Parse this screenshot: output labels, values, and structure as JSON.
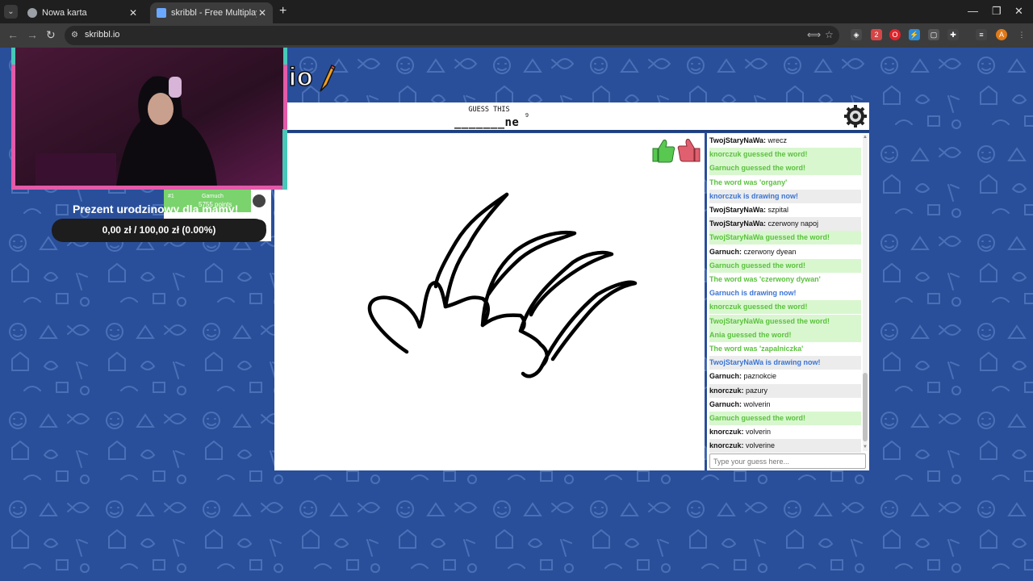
{
  "browser": {
    "tabs": [
      {
        "title": "Nowa karta",
        "active": false
      },
      {
        "title": "skribbl - Free Multiplayer Drawi",
        "active": true
      }
    ],
    "url": "skribbl.io"
  },
  "game": {
    "logo_suffix": "io",
    "header_label": "GUESS THIS",
    "hint": "_______ne",
    "hint_count": "9",
    "chat": [
      {
        "name": "TwojStaryNaWa:",
        "text": " wrecz",
        "kind": "plain",
        "alt": false
      },
      {
        "text": "knorczuk guessed the word!",
        "kind": "green",
        "bg": true
      },
      {
        "text": "Garnuch guessed the word!",
        "kind": "green",
        "bg": true
      },
      {
        "text": "The word was 'organy'",
        "kind": "green",
        "bg": false
      },
      {
        "text": "knorczuk is drawing now!",
        "kind": "blue",
        "alt": true
      },
      {
        "name": "TwojStaryNaWa:",
        "text": " szpital",
        "kind": "plain",
        "alt": false
      },
      {
        "name": "TwojStaryNaWa:",
        "text": " czerwony napoj",
        "kind": "plain",
        "alt": true
      },
      {
        "text": "TwojStaryNaWa guessed the word!",
        "kind": "green",
        "bg": true
      },
      {
        "name": "Garnuch:",
        "text": " czerwony dyean",
        "kind": "plain",
        "alt": false
      },
      {
        "text": "Garnuch guessed the word!",
        "kind": "green",
        "bg": true
      },
      {
        "text": "The word was 'czerwony dywan'",
        "kind": "green",
        "bg": false
      },
      {
        "text": "Garnuch is drawing now!",
        "kind": "blue",
        "alt": false
      },
      {
        "text": "knorczuk guessed the word!",
        "kind": "green",
        "bg": true
      },
      {
        "text": "TwojStaryNaWa guessed the word!",
        "kind": "green",
        "bg": true
      },
      {
        "text": "Ania guessed the word!",
        "kind": "green",
        "bg": true
      },
      {
        "text": "The word was 'zapalniczka'",
        "kind": "green",
        "bg": false
      },
      {
        "text": "TwojStaryNaWa is drawing now!",
        "kind": "blue",
        "alt": true
      },
      {
        "name": "Garnuch:",
        "text": " paznokcie",
        "kind": "plain",
        "alt": false
      },
      {
        "name": "knorczuk:",
        "text": " pazury",
        "kind": "plain",
        "alt": true
      },
      {
        "name": "Garnuch:",
        "text": " wolverin",
        "kind": "plain",
        "alt": false
      },
      {
        "text": "Garnuch guessed the word!",
        "kind": "green",
        "bg": true
      },
      {
        "name": "knorczuk:",
        "text": " volverin",
        "kind": "plain",
        "alt": false
      },
      {
        "name": "knorczuk:",
        "text": " volverine",
        "kind": "plain",
        "alt": true
      }
    ],
    "chat_placeholder": "Type your guess here...",
    "leader": {
      "rank": "#1",
      "name": "Garnuch",
      "points": "5755 points"
    }
  },
  "overlay": {
    "donation_label": "Prezent urodzinowy dla mamy!",
    "donation_amount": "0,00 zł / 100,00 zł (0.00%)",
    "donation_progress": 0
  }
}
